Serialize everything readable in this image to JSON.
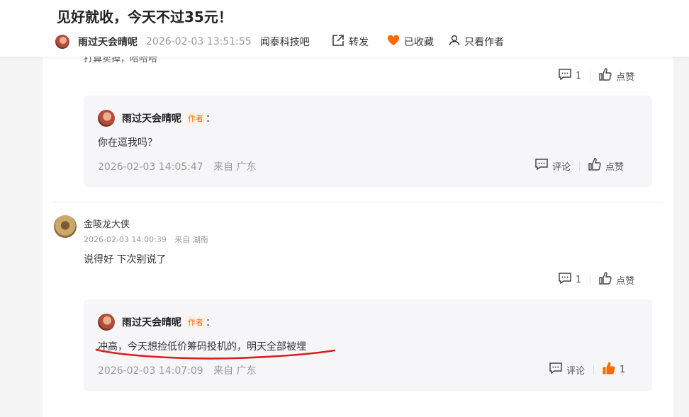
{
  "header": {
    "title": "见好就收，今天不过35元！",
    "author": "雨过天会晴呢",
    "time": "2026-02-03 13:51:55",
    "bar": "闻泰科技吧",
    "share_label": "转发",
    "fav_label": "已收藏",
    "only_author_label": "只看作者",
    "fav_color": "#ff6a00"
  },
  "prev_comment": {
    "clipped_text": "打算卖掉，哈哈哈",
    "reply_count": "1",
    "like_label": "点赞"
  },
  "replies": [
    {
      "name": "雨过天会晴呢",
      "tag": "作者",
      "colon": "：",
      "text": "你在逗我吗？",
      "time": "2026-02-03 14:05:47",
      "location": "来自 广东",
      "comment_label": "评论",
      "like_label": "点赞"
    },
    {
      "name": "雨过天会晴呢",
      "tag": "作者",
      "colon": "：",
      "text": "冲高，今天想捡低价筹码投机的，明天全部被埋",
      "time": "2026-02-03 14:07:09",
      "location": "来自 广东",
      "comment_label": "评论",
      "like_count": "1",
      "like_color": "#ff6a00"
    }
  ],
  "comment": {
    "name": "金陵龙大侠",
    "time": "2026-02-03 14:00:39",
    "location": "来自 湖南",
    "text": "说得好 下次别说了",
    "reply_count": "1",
    "like_label": "点赞"
  },
  "annotation_color": "#d9201f"
}
